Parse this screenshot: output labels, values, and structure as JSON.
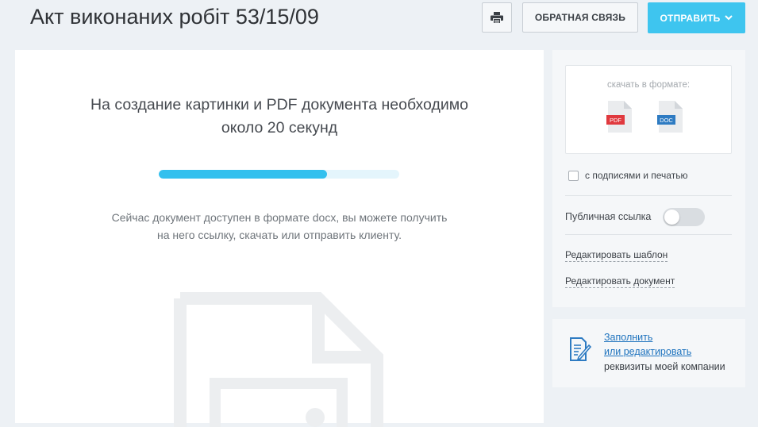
{
  "header": {
    "title": "Акт виконаних робіт 53/15/09",
    "feedback_label": "ОБРАТНАЯ СВЯЗЬ",
    "send_label": "ОТПРАВИТЬ",
    "print_icon": "printer-icon",
    "send_icon": "chevron-down-icon"
  },
  "main": {
    "heading_line1": "На создание картинки и PDF документа необходимо",
    "heading_line2": "около 20 секунд",
    "progress": 0.7,
    "note_line1": "Сейчас документ доступен в формате docx, вы можете получить",
    "note_line2": "на него ссылку, скачать или отправить клиенту.",
    "placeholder_icon": "document-image-icon"
  },
  "sidebar": {
    "download_label": "скачать в формате:",
    "formats": [
      {
        "label": "PDF",
        "color": "#e0393e",
        "icon": "pdf-file-icon"
      },
      {
        "label": "DOC",
        "color": "#2e7bc2",
        "icon": "doc-file-icon"
      }
    ],
    "signatures_label": "с подписями и печатью",
    "signatures_checked": false,
    "public_link_label": "Публичная ссылка",
    "public_link_enabled": false,
    "edit_template_label": "Редактировать шаблон",
    "edit_document_label": "Редактировать документ"
  },
  "company": {
    "icon": "edit-document-icon",
    "link_line1": "Заполнить",
    "link_line2": "или редактировать",
    "text": "реквизиты моей компании"
  },
  "colors": {
    "accent": "#3ec5ef",
    "progress_fill": "#33c0ee",
    "progress_track": "#e4f5fc",
    "link": "#1e73be",
    "page_bg": "#edf1f5"
  }
}
